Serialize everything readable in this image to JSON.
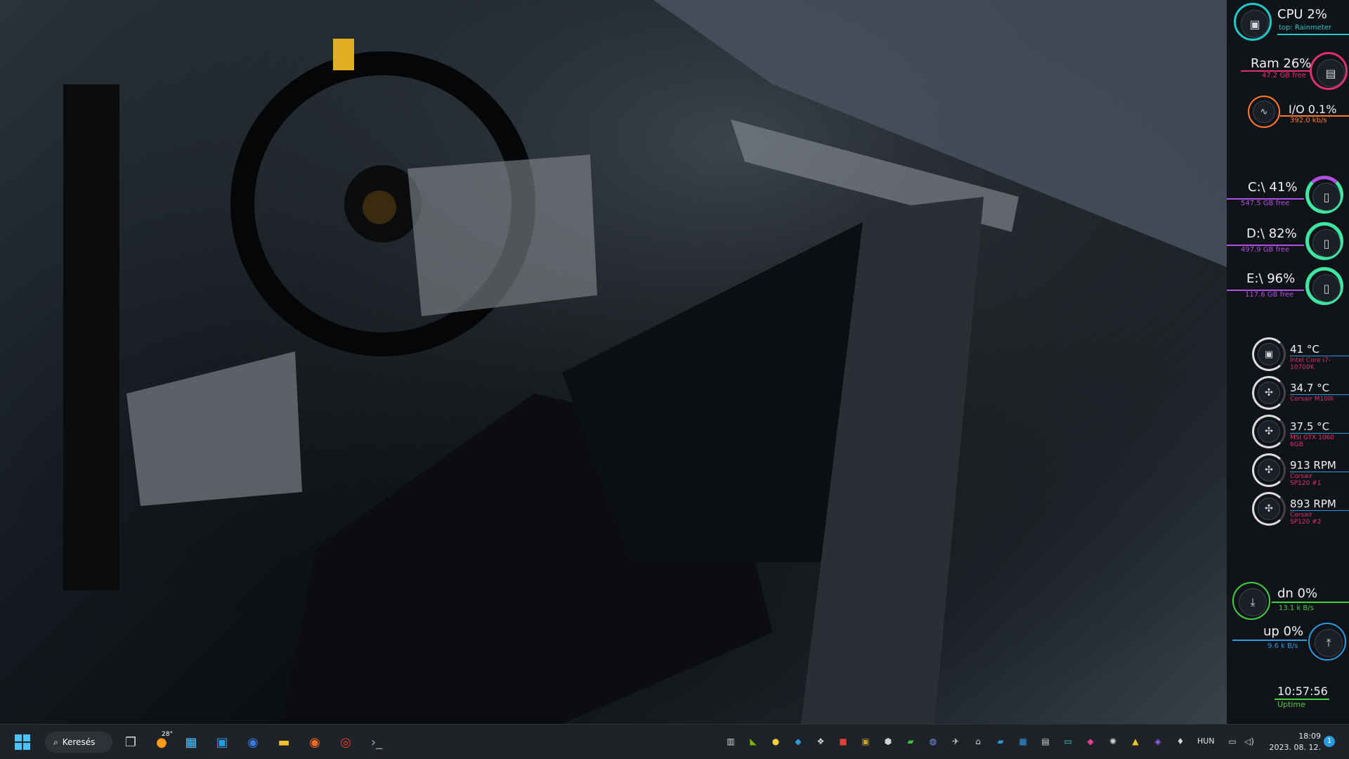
{
  "widgets": {
    "cpu": {
      "label": "CPU 2%",
      "sub": "top: Rainmeter",
      "color": "#1ec8c8",
      "level": 0.02
    },
    "ram": {
      "label": "Ram 26%",
      "sub": "47.2 GB free",
      "color": "#e0306a",
      "level": 0.26
    },
    "io": {
      "label": "I/O 0.1%",
      "sub": "392.0 kb/s",
      "color": "#ff7a2a",
      "level": 0.01
    },
    "drives": [
      {
        "label": "C:\\ 41%",
        "sub": "547.5 GB free",
        "level": 0.41
      },
      {
        "label": "D:\\ 82%",
        "sub": "497.9 GB free",
        "level": 0.82
      },
      {
        "label": "E:\\ 96%",
        "sub": "117.6 GB free",
        "level": 0.96
      }
    ],
    "drive_color": "#b050e0",
    "drive_ring_color": "#3ee6a0",
    "temps": [
      {
        "value": "41 °C",
        "sub": "Intel Core i7-10700K",
        "icon": "cpu-icon"
      },
      {
        "value": "34.7 °C",
        "sub": "Corsair M100i",
        "icon": "fan-icon"
      },
      {
        "value": "37.5 °C",
        "sub": "MSI GTX 1060 6GB",
        "icon": "fan-icon"
      },
      {
        "value": "913 RPM",
        "sub": "Corsair SP120 #1",
        "icon": "fan-icon"
      },
      {
        "value": "893 RPM",
        "sub": "Corsair SP120 #2",
        "icon": "fan-icon"
      }
    ],
    "temp_sub_color": "#e0306a",
    "net_down": {
      "label": "dn 0%",
      "sub": "13.1 k B/s",
      "color": "#40d040"
    },
    "net_up": {
      "label": "up 0%",
      "sub": "9.6 k B/s",
      "color": "#2a9ae0"
    },
    "clock": {
      "time": "10:57:56",
      "label": "Uptime"
    }
  },
  "taskbar": {
    "search_label": "Keresés",
    "weather_temp": "28°",
    "language": "HUN",
    "time": "18:09",
    "date": "2023. 08. 12.",
    "notification_count": "1"
  }
}
